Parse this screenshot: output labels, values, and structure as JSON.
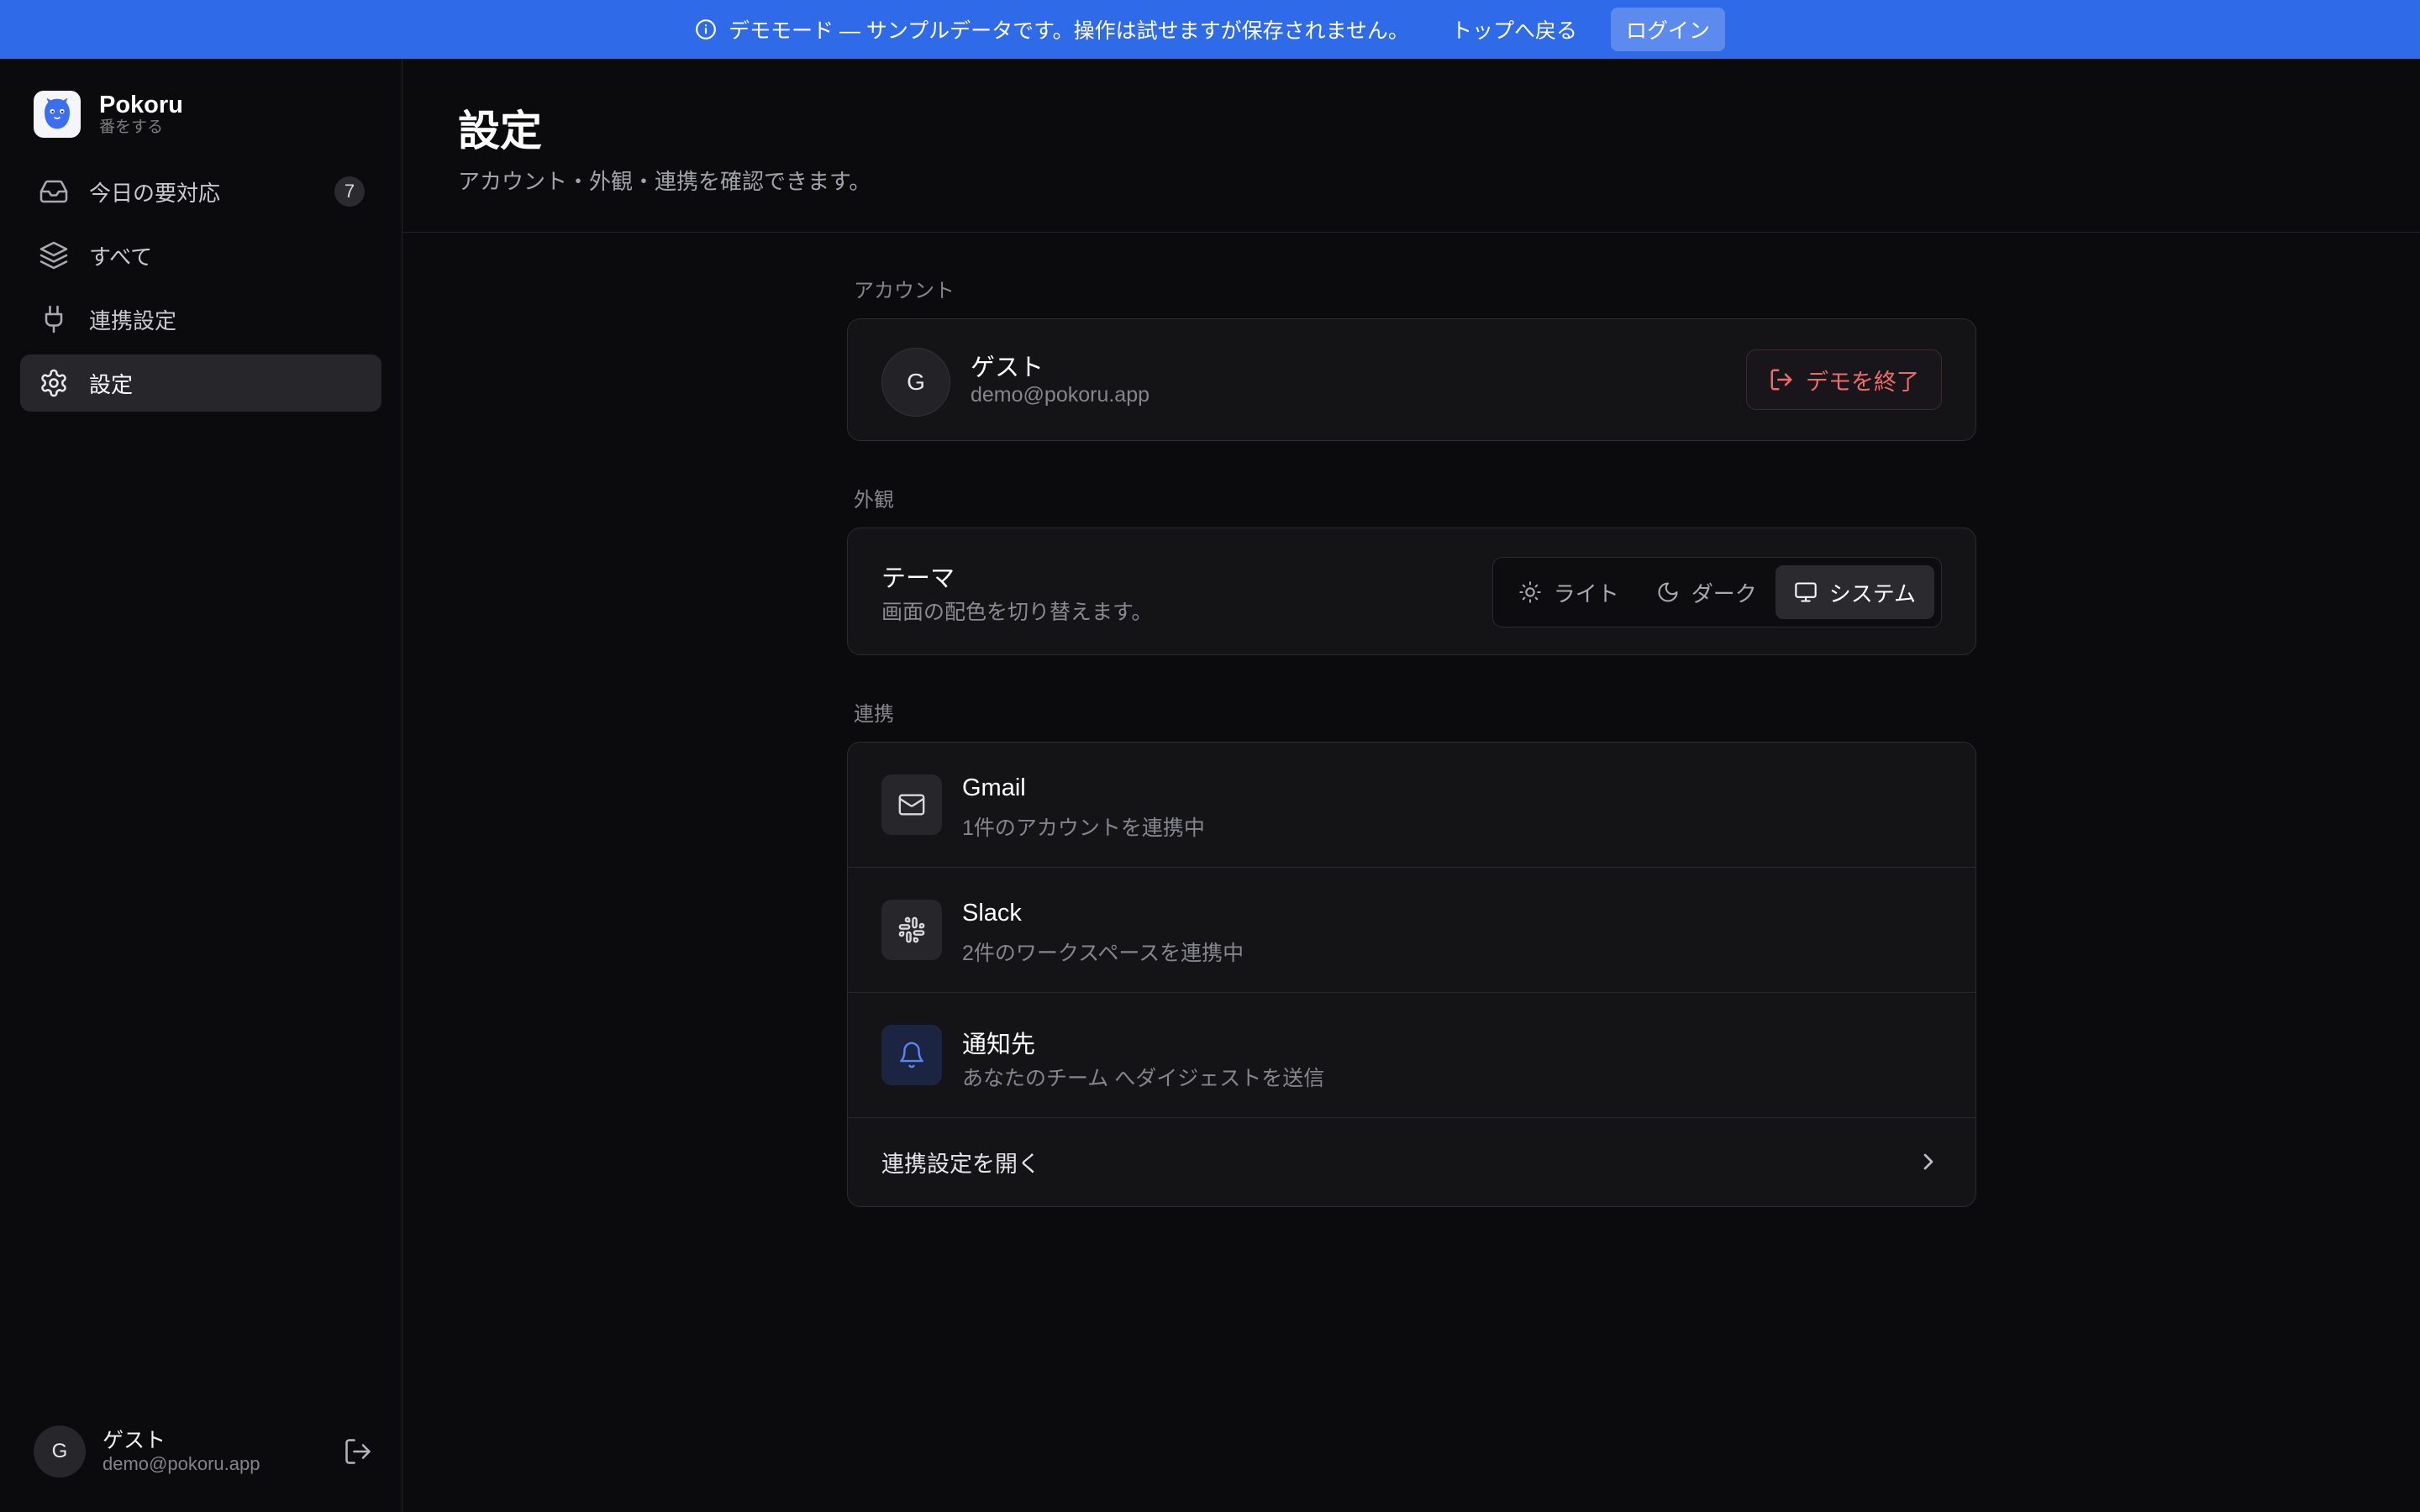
{
  "banner": {
    "message": "デモモード — サンプルデータです。操作は試せますが保存されません。",
    "back_link": "トップへ戻る",
    "login_button": "ログイン"
  },
  "app": {
    "name": "Pokoru",
    "tagline": "番をする"
  },
  "sidebar": {
    "items": [
      {
        "label": "今日の要対応",
        "icon": "inbox-icon",
        "badge": "7"
      },
      {
        "label": "すべて",
        "icon": "layers-icon"
      },
      {
        "label": "連携設定",
        "icon": "plug-icon"
      },
      {
        "label": "設定",
        "icon": "gear-icon",
        "active": true
      }
    ]
  },
  "user": {
    "initial": "G",
    "name": "ゲスト",
    "email": "demo@pokoru.app"
  },
  "page": {
    "title": "設定",
    "subtitle": "アカウント・外観・連携を確認できます。"
  },
  "account": {
    "section_label": "アカウント",
    "initial": "G",
    "name": "ゲスト",
    "email": "demo@pokoru.app",
    "end_demo_label": "デモを終了"
  },
  "appearance": {
    "section_label": "外観",
    "theme_title": "テーマ",
    "theme_desc": "画面の配色を切り替えます。",
    "options": [
      {
        "label": "ライト",
        "icon": "sun-icon"
      },
      {
        "label": "ダーク",
        "icon": "moon-icon"
      },
      {
        "label": "システム",
        "icon": "monitor-icon",
        "selected": true
      }
    ]
  },
  "integrations": {
    "section_label": "連携",
    "items": [
      {
        "title": "Gmail",
        "desc": "1件のアカウントを連携中",
        "icon": "mail-icon"
      },
      {
        "title": "Slack",
        "desc": "2件のワークスペースを連携中",
        "icon": "slack-icon"
      },
      {
        "title": "通知先",
        "desc": "あなたのチーム へダイジェストを送信",
        "icon": "bell-icon"
      }
    ],
    "open_label": "連携設定を開く"
  },
  "colors": {
    "banner": "#2f6ae8",
    "danger": "#f06a6a",
    "accent_blue": "#5b86f2",
    "background": "#0b0b0d"
  }
}
